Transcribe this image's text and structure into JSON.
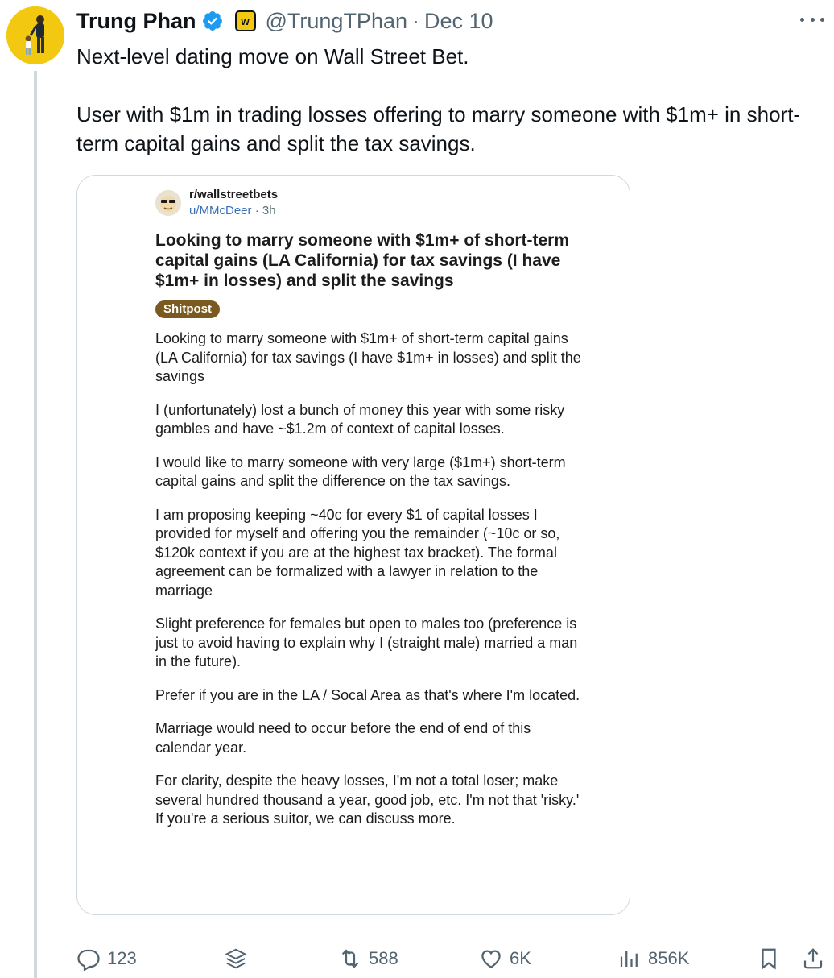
{
  "tweet": {
    "display_name": "Trung Phan",
    "handle": "@TrungTPhan",
    "separator": "·",
    "date": "Dec 10",
    "affiliate_badge": "w",
    "text_paragraphs": [
      "Next-level dating move on Wall Street Bet.",
      "User with $1m in trading losses offering to marry someone with $1m+ in short-term capital gains and split the tax savings."
    ]
  },
  "reddit_post": {
    "subreddit": "r/wallstreetbets",
    "username": "u/MMcDeer",
    "dot": "·",
    "age": "3h",
    "title": "Looking to marry someone with $1m+ of short-term capital gains (LA California) for tax savings (I have $1m+ in losses) and split the savings",
    "flair": "Shitpost",
    "body": [
      "Looking to marry someone with $1m+ of short-term capital gains (LA California) for tax savings (I have $1m+ in  losses) and split the savings",
      "I (unfortunately) lost a bunch of money this year with some risky gambles and have ~$1.2m of context of capital losses.",
      "I would like to marry someone with very large ($1m+) short-term capital gains and split the difference on the tax savings.",
      "I am proposing keeping ~40c for every $1 of capital losses I provided for myself and offering you the remainder (~10c or so, $120k context if you are at the highest tax bracket). The formal agreement can be formalized with a lawyer in relation to the marriage",
      "Slight preference for females but open to males too (preference is just to avoid having to explain why I (straight male) married a man in the future).",
      "Prefer if you are in the LA / Socal Area as that's where I'm located.",
      "Marriage would need to occur before the end of end of this calendar year.",
      "For clarity, despite the heavy losses, I'm not a total loser; make several hundred thousand a year, good job, etc. I'm not that 'risky.' If you're a serious suitor, we can discuss more."
    ]
  },
  "actions": {
    "replies": "123",
    "reposts": "588",
    "likes": "6K",
    "views": "856K"
  },
  "colors": {
    "verified_blue": "#1d9bf0",
    "secondary_text": "#536471",
    "avatar_bg": "#f2c811",
    "flair_bg": "#7a5a1e"
  },
  "icons": [
    "verified-icon",
    "more-icon",
    "reply-icon",
    "grok-icon",
    "repost-icon",
    "like-icon",
    "views-icon",
    "bookmark-icon",
    "share-icon"
  ]
}
